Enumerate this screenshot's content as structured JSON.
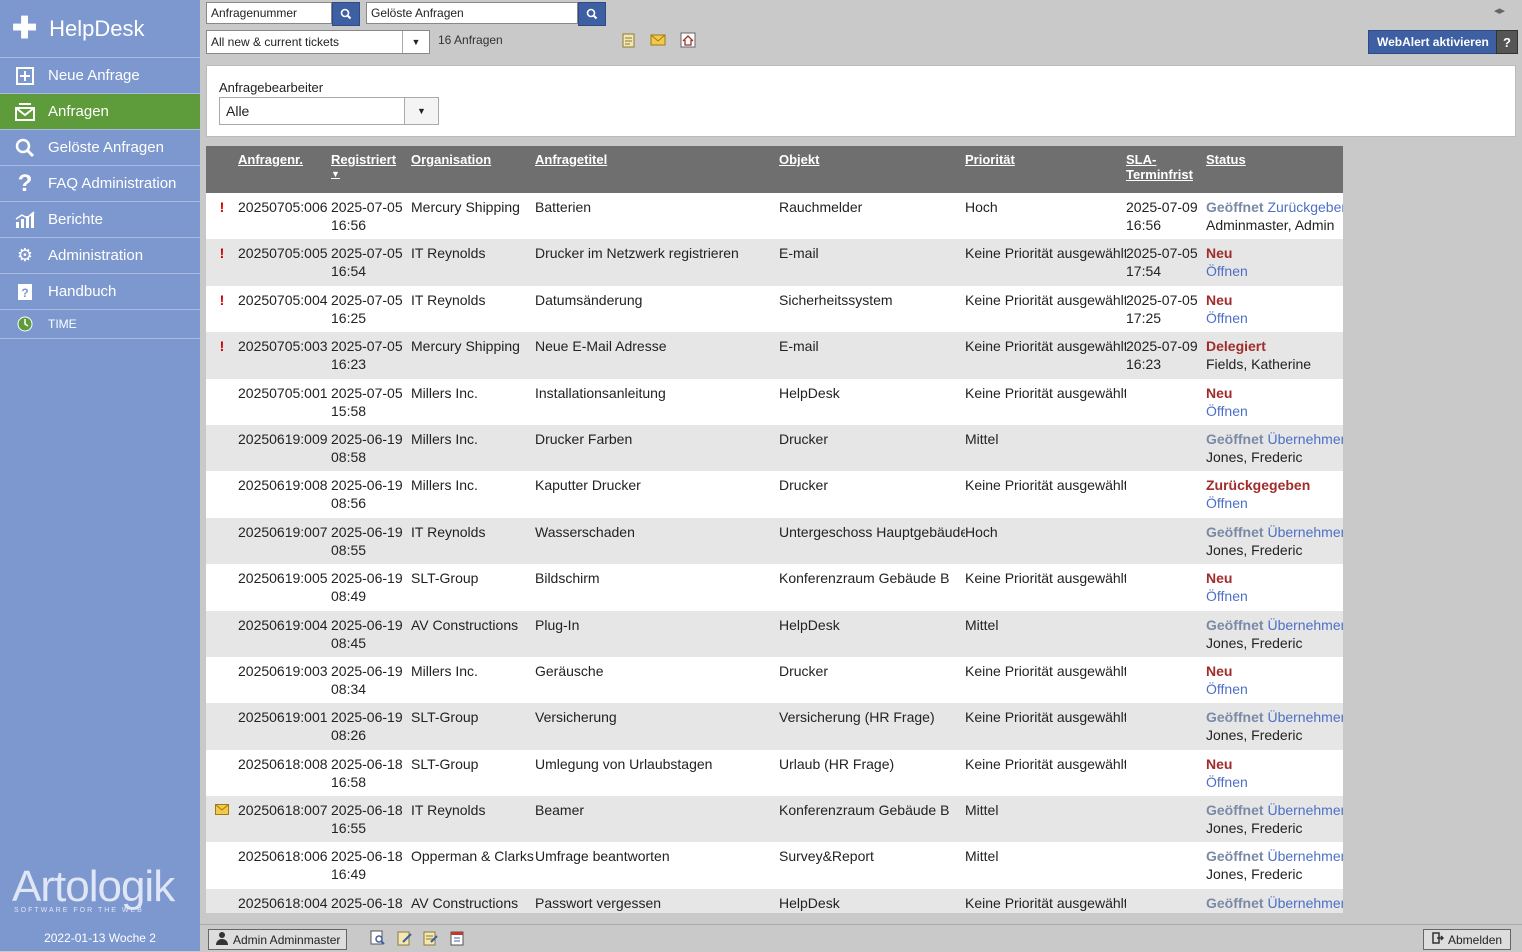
{
  "app": {
    "title": "HelpDesk"
  },
  "sidebar": {
    "items": [
      {
        "label": "Neue Anfrage",
        "icon": "plus-square-icon"
      },
      {
        "label": "Anfragen",
        "icon": "inbox-icon"
      },
      {
        "label": "Gelöste Anfragen",
        "icon": "search-icon"
      },
      {
        "label": "FAQ Administration",
        "icon": "question-icon"
      },
      {
        "label": "Berichte",
        "icon": "chart-icon"
      },
      {
        "label": "Administration",
        "icon": "gears-icon"
      },
      {
        "label": "Handbuch",
        "icon": "book-icon"
      }
    ],
    "time_label": "TIME",
    "logo": "Artologik",
    "logo_sub": "SOFTWARE FOR THE WEB",
    "date_week": "2022-01-13  Woche 2"
  },
  "topbar": {
    "search1_value": "Anfragenummer",
    "search2_value": "Gelöste Anfragen",
    "filter_value": "All new & current tickets",
    "count": "16 Anfragen",
    "webalert": "WebAlert aktivieren",
    "help": "?"
  },
  "filter_panel": {
    "label": "Anfragebearbeiter",
    "value": "Alle"
  },
  "table": {
    "headers": {
      "nr": "Anfragenr.",
      "reg": "Registriert",
      "org": "Organisation",
      "title": "Anfragetitel",
      "obj": "Objekt",
      "prio": "Priorität",
      "sla1": "SLA-",
      "sla2": "Terminfrist",
      "status": "Status"
    },
    "rows": [
      {
        "flag": "!",
        "nr": "20250705:006",
        "reg1": "2025-07-05",
        "reg2": "16:56",
        "org": "Mercury Shipping",
        "title": "Batterien",
        "obj": "Rauchmelder",
        "prio": "Hoch",
        "sla1": "2025-07-09",
        "sla2": "16:56",
        "st": "Geöffnet",
        "stlink": "Zurückgeben",
        "st2": "Adminmaster, Admin",
        "st2link": ""
      },
      {
        "flag": "!",
        "nr": "20250705:005",
        "reg1": "2025-07-05",
        "reg2": "16:54",
        "org": "IT Reynolds",
        "title": "Drucker im Netzwerk registrieren",
        "obj": "E-mail",
        "prio": "Keine Priorität ausgewählt",
        "sla1": "2025-07-05",
        "sla2": "17:54",
        "st": "Neu",
        "stlink": "",
        "st2": "",
        "st2link": "Öffnen"
      },
      {
        "flag": "!",
        "nr": "20250705:004",
        "reg1": "2025-07-05",
        "reg2": "16:25",
        "org": "IT Reynolds",
        "title": "Datumsänderung",
        "obj": "Sicherheitssystem",
        "prio": "Keine Priorität ausgewählt",
        "sla1": "2025-07-05",
        "sla2": "17:25",
        "st": "Neu",
        "stlink": "",
        "st2": "",
        "st2link": "Öffnen"
      },
      {
        "flag": "!",
        "nr": "20250705:003",
        "reg1": "2025-07-05",
        "reg2": "16:23",
        "org": "Mercury Shipping",
        "title": "Neue E-Mail Adresse",
        "obj": "E-mail",
        "prio": "Keine Priorität ausgewählt",
        "sla1": "2025-07-09",
        "sla2": "16:23",
        "st": "Delegiert",
        "stlink": "",
        "st2": "Fields, Katherine",
        "st2link": ""
      },
      {
        "flag": "",
        "nr": "20250705:001",
        "reg1": "2025-07-05",
        "reg2": "15:58",
        "org": "Millers Inc.",
        "title": "Installationsanleitung",
        "obj": "HelpDesk",
        "prio": "Keine Priorität ausgewählt",
        "sla1": "",
        "sla2": "",
        "st": "Neu",
        "stlink": "",
        "st2": "",
        "st2link": "Öffnen"
      },
      {
        "flag": "",
        "nr": "20250619:009",
        "reg1": "2025-06-19",
        "reg2": "08:58",
        "org": "Millers Inc.",
        "title": "Drucker Farben",
        "obj": "Drucker",
        "prio": "Mittel",
        "sla1": "",
        "sla2": "",
        "st": "Geöffnet",
        "stlink": "Übernehmen",
        "st2": "Jones, Frederic",
        "st2link": ""
      },
      {
        "flag": "",
        "nr": "20250619:008",
        "reg1": "2025-06-19",
        "reg2": "08:56",
        "org": "Millers Inc.",
        "title": "Kaputter Drucker",
        "obj": "Drucker",
        "prio": "Keine Priorität ausgewählt",
        "sla1": "",
        "sla2": "",
        "st": "Zurückgegeben",
        "stlink": "",
        "st2": "",
        "st2link": "Öffnen"
      },
      {
        "flag": "",
        "nr": "20250619:007",
        "reg1": "2025-06-19",
        "reg2": "08:55",
        "org": "IT Reynolds",
        "title": "Wasserschaden",
        "obj": "Untergeschoss Hauptgebäude",
        "prio": "Hoch",
        "sla1": "",
        "sla2": "",
        "st": "Geöffnet",
        "stlink": "Übernehmen",
        "st2": "Jones, Frederic",
        "st2link": ""
      },
      {
        "flag": "",
        "nr": "20250619:005",
        "reg1": "2025-06-19",
        "reg2": "08:49",
        "org": "SLT-Group",
        "title": "Bildschirm",
        "obj": "Konferenzraum Gebäude B",
        "prio": "Keine Priorität ausgewählt",
        "sla1": "",
        "sla2": "",
        "st": "Neu",
        "stlink": "",
        "st2": "",
        "st2link": "Öffnen"
      },
      {
        "flag": "",
        "nr": "20250619:004",
        "reg1": "2025-06-19",
        "reg2": "08:45",
        "org": "AV Constructions",
        "title": "Plug-In",
        "obj": "HelpDesk",
        "prio": "Mittel",
        "sla1": "",
        "sla2": "",
        "st": "Geöffnet",
        "stlink": "Übernehmen",
        "st2": "Jones, Frederic",
        "st2link": ""
      },
      {
        "flag": "",
        "nr": "20250619:003",
        "reg1": "2025-06-19",
        "reg2": "08:34",
        "org": "Millers Inc.",
        "title": "Geräusche",
        "obj": "Drucker",
        "prio": "Keine Priorität ausgewählt",
        "sla1": "",
        "sla2": "",
        "st": "Neu",
        "stlink": "",
        "st2": "",
        "st2link": "Öffnen"
      },
      {
        "flag": "",
        "nr": "20250619:001",
        "reg1": "2025-06-19",
        "reg2": "08:26",
        "org": "SLT-Group",
        "title": "Versicherung",
        "obj": "Versicherung (HR Frage)",
        "prio": "Keine Priorität ausgewählt",
        "sla1": "",
        "sla2": "",
        "st": "Geöffnet",
        "stlink": "Übernehmen",
        "st2": "Jones, Frederic",
        "st2link": ""
      },
      {
        "flag": "",
        "nr": "20250618:008",
        "reg1": "2025-06-18",
        "reg2": "16:58",
        "org": "SLT-Group",
        "title": "Umlegung von Urlaubstagen",
        "obj": "Urlaub (HR Frage)",
        "prio": "Keine Priorität ausgewählt",
        "sla1": "",
        "sla2": "",
        "st": "Neu",
        "stlink": "",
        "st2": "",
        "st2link": "Öffnen"
      },
      {
        "flag": "mail",
        "nr": "20250618:007",
        "reg1": "2025-06-18",
        "reg2": "16:55",
        "org": "IT Reynolds",
        "title": "Beamer",
        "obj": "Konferenzraum Gebäude B",
        "prio": "Mittel",
        "sla1": "",
        "sla2": "",
        "st": "Geöffnet",
        "stlink": "Übernehmen",
        "st2": "Jones, Frederic",
        "st2link": ""
      },
      {
        "flag": "",
        "nr": "20250618:006",
        "reg1": "2025-06-18",
        "reg2": "16:49",
        "org": "Opperman & Clarks",
        "title": "Umfrage beantworten",
        "obj": "Survey&Report",
        "prio": "Mittel",
        "sla1": "",
        "sla2": "",
        "st": "Geöffnet",
        "stlink": "Übernehmen",
        "st2": "Jones, Frederic",
        "st2link": ""
      },
      {
        "flag": "",
        "nr": "20250618:004",
        "reg1": "2025-06-18",
        "reg2": "",
        "org": "AV Constructions",
        "title": "Passwort vergessen",
        "obj": "HelpDesk",
        "prio": "Keine Priorität ausgewählt",
        "sla1": "",
        "sla2": "",
        "st": "Geöffnet",
        "stlink": "Übernehmen",
        "st2": "",
        "st2link": ""
      }
    ]
  },
  "bottombar": {
    "user": "Admin Adminmaster",
    "logout": "Abmelden"
  },
  "colors": {
    "sidebar": "#7d97cf",
    "active": "#5e9b3a",
    "header": "#6f6f6f",
    "status_open": "#7a8aa6",
    "status_red": "#a02c2c",
    "link": "#4d6fc5"
  }
}
